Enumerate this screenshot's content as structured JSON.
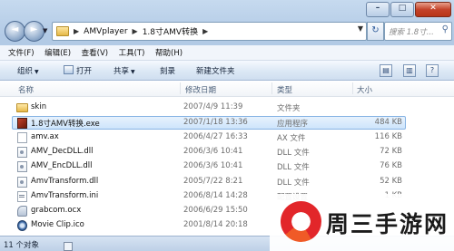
{
  "titlebar": {
    "min": "–",
    "max": "□",
    "close": "✕"
  },
  "nav": {
    "back": "◄",
    "forward": "►",
    "dropdown": "▼"
  },
  "address": {
    "crumbs": [
      "AMVplayer",
      "1.8寸AMV转换"
    ],
    "separator": "▶",
    "tail": "▼"
  },
  "refresh": "↻",
  "search": {
    "placeholder": "搜索 1.8寸...",
    "icon": "⚲"
  },
  "menu": [
    "文件(F)",
    "编辑(E)",
    "查看(V)",
    "工具(T)",
    "帮助(H)"
  ],
  "toolbar": {
    "organize": "组织",
    "open": "打开",
    "share": "共享",
    "burn": "刻录",
    "new_folder": "新建文件夹",
    "arrow": "▼"
  },
  "columns": {
    "name": "名称",
    "date": "修改日期",
    "type": "类型",
    "size": "大小"
  },
  "files": [
    {
      "name": "skin",
      "date": "2007/4/9 11:39",
      "type": "文件夹",
      "size": "",
      "icon": "folder-icon"
    },
    {
      "name": "1.8寸AMV转换.exe",
      "date": "2007/1/18 13:36",
      "type": "应用程序",
      "size": "484 KB",
      "icon": "exe-icon",
      "selected": true
    },
    {
      "name": "amv.ax",
      "date": "2006/4/27 16:33",
      "type": "AX 文件",
      "size": "116 KB",
      "icon": "file-icon"
    },
    {
      "name": "AMV_DecDLL.dll",
      "date": "2006/3/6 10:41",
      "type": "DLL 文件",
      "size": "72 KB",
      "icon": "dll-icon"
    },
    {
      "name": "AMV_EncDLL.dll",
      "date": "2006/3/6 10:41",
      "type": "DLL 文件",
      "size": "76 KB",
      "icon": "dll-icon"
    },
    {
      "name": "AmvTransform.dll",
      "date": "2005/7/22 8:21",
      "type": "DLL 文件",
      "size": "52 KB",
      "icon": "dll-icon"
    },
    {
      "name": "AmvTransform.ini",
      "date": "2006/8/14 14:28",
      "type": "配置设置",
      "size": "1 KB",
      "icon": "ini-icon"
    },
    {
      "name": "grabcom.ocx",
      "date": "2006/6/29 15:50",
      "type": "",
      "size": "",
      "icon": "ocx-icon"
    },
    {
      "name": "Movie Clip.ico",
      "date": "2001/8/14 20:18",
      "type": "",
      "size": "",
      "icon": "ico-icon"
    }
  ],
  "status": {
    "count": "11 个对象"
  },
  "watermark": {
    "text": "周三手游网"
  }
}
